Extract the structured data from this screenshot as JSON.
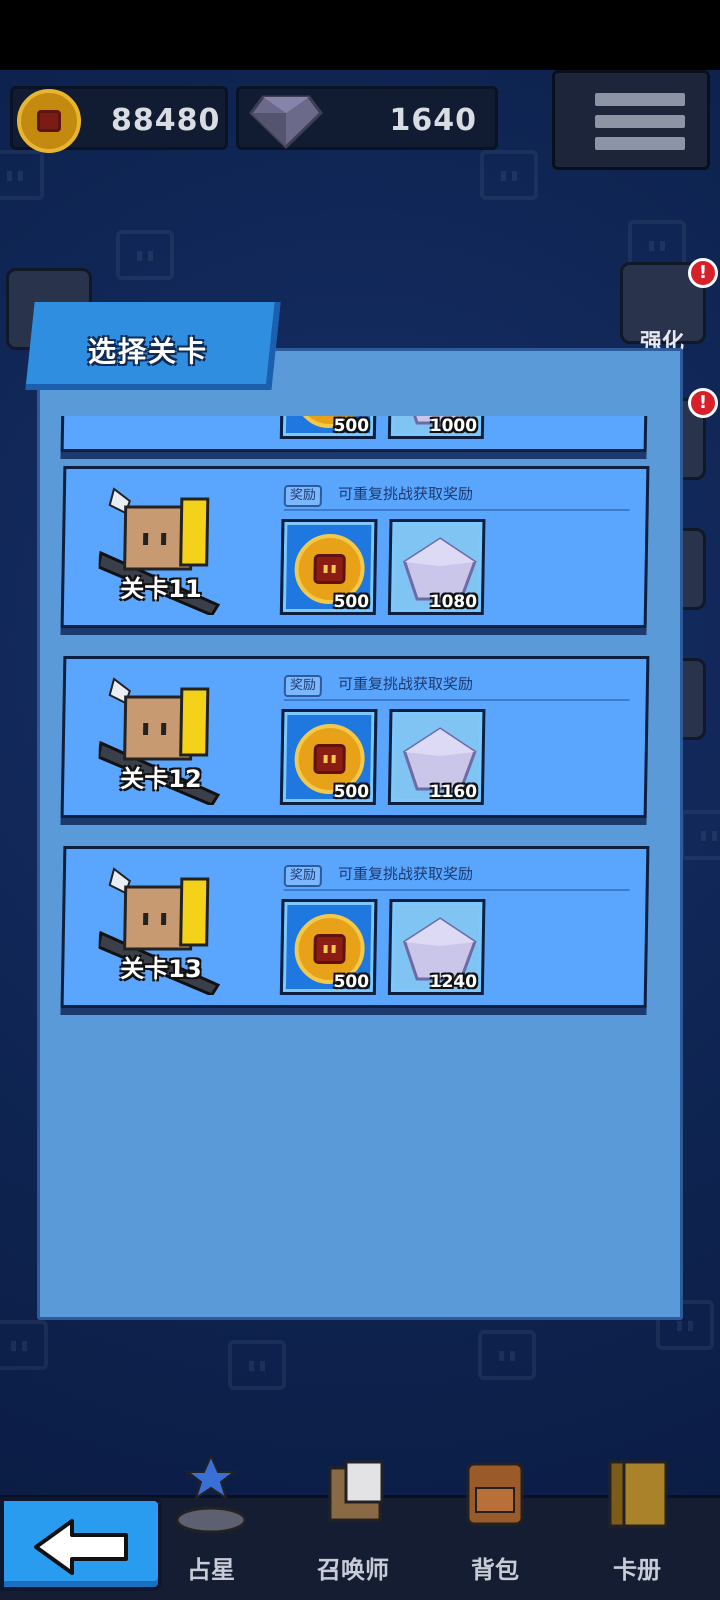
{
  "resources": {
    "coins": "88480",
    "gems": "1640"
  },
  "side_menu": {
    "right_items": [
      {
        "label": "强化",
        "alert": "!"
      },
      {
        "label": "",
        "alert": "!"
      }
    ]
  },
  "dialog": {
    "title": "选择关卡",
    "reward_tag": "奖励",
    "reward_desc": "可重复挑战获取奖励",
    "partial_level": {
      "coin_qty": "500",
      "gem_qty": "1000"
    },
    "levels": [
      {
        "name": "关卡11",
        "coin_qty": "500",
        "gem_qty": "1080"
      },
      {
        "name": "关卡12",
        "coin_qty": "500",
        "gem_qty": "1160"
      },
      {
        "name": "关卡13",
        "coin_qty": "500",
        "gem_qty": "1240"
      }
    ]
  },
  "bottom_nav": {
    "items": [
      "占星",
      "召唤师",
      "背包",
      "卡册"
    ]
  },
  "colors": {
    "background": "#0e2352",
    "dialog": "#5a9ad8",
    "card": "#5aa6ff",
    "coin": "#e8a21a",
    "gem": "#c9c6ea"
  },
  "icons": {
    "back": "back-arrow-icon",
    "menu": "hamburger-menu-icon",
    "coin": "coin-icon",
    "gem": "gem-icon"
  }
}
